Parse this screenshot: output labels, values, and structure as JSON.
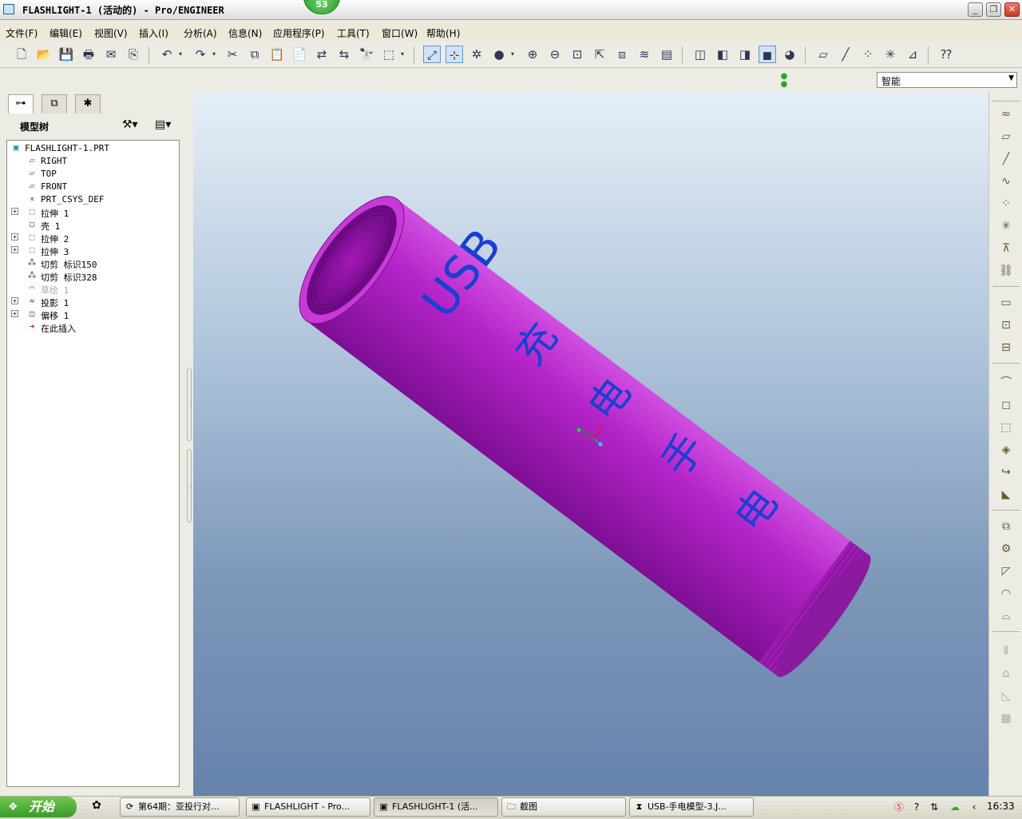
{
  "window": {
    "title": "FLASHLIGHT-1 (活动的) - Pro/ENGINEER",
    "badge": "53"
  },
  "menu": [
    "文件(F)",
    "编辑(E)",
    "视图(V)",
    "插入(I)",
    "分析(A)",
    "信息(N)",
    "应用程序(P)",
    "工具(T)",
    "窗口(W)",
    "帮助(H)"
  ],
  "filter": {
    "value": "智能"
  },
  "left_panel": {
    "title": "模型树",
    "tree": [
      {
        "label": "FLASHLIGHT-1.PRT",
        "icon": "part-icon",
        "root": true
      },
      {
        "label": "RIGHT",
        "icon": "datum-plane-icon"
      },
      {
        "label": "TOP",
        "icon": "datum-plane-icon"
      },
      {
        "label": "FRONT",
        "icon": "datum-plane-icon"
      },
      {
        "label": "PRT_CSYS_DEF",
        "icon": "csys-icon"
      },
      {
        "label": "拉伸 1",
        "icon": "extrude-icon",
        "expandable": true
      },
      {
        "label": "壳 1",
        "icon": "shell-icon"
      },
      {
        "label": "拉伸 2",
        "icon": "extrude-icon",
        "expandable": true
      },
      {
        "label": "拉伸 3",
        "icon": "extrude-icon",
        "expandable": true
      },
      {
        "label": "切剪 标识150",
        "icon": "cut-icon"
      },
      {
        "label": "切剪 标识328",
        "icon": "cut-icon"
      },
      {
        "label": "草绘 1",
        "icon": "sketch-icon",
        "dim": true
      },
      {
        "label": "投影 1",
        "icon": "project-icon",
        "expandable": true
      },
      {
        "label": "偏移 1",
        "icon": "offset-icon",
        "expandable": true
      },
      {
        "label": "在此插入",
        "icon": "insert-arrow-icon"
      }
    ]
  },
  "model": {
    "color": "#b020c0",
    "text_line1": "USB",
    "text_chars": [
      "充",
      "电",
      "手",
      "电"
    ],
    "text_color": "#1a3fd0"
  },
  "taskbar": {
    "start": "开始",
    "tasks": [
      {
        "label": "第64期：亚投行对...",
        "icon": "browser-icon"
      },
      {
        "label": "FLASHLIGHT - Pro...",
        "icon": "proe-window-icon"
      },
      {
        "label": "FLASHLIGHT-1 (活...",
        "icon": "proe-window-icon",
        "active": true
      },
      {
        "label": "截图",
        "icon": "folder-icon"
      },
      {
        "label": "USB-手电模型-3.J...",
        "icon": "image-viewer-icon"
      }
    ],
    "clock": "16:33"
  }
}
